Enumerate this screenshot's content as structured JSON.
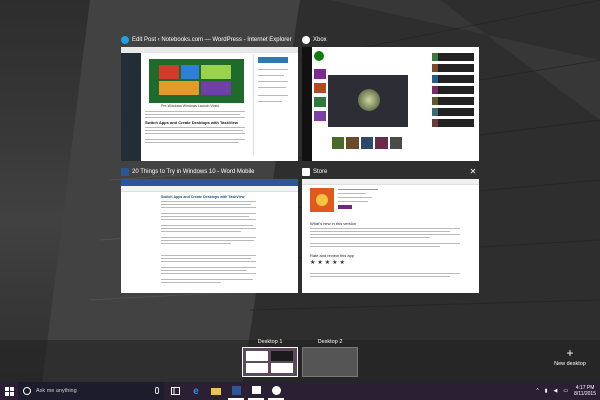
{
  "windows": [
    {
      "title": "Edit Post ‹ Notebooks.com — WordPress - Internet Explorer",
      "icon": "ie-icon"
    },
    {
      "title": "Xbox",
      "icon": "xbox-icon"
    },
    {
      "title": "20 Things to Try in Windows 10 - Word Mobile",
      "icon": "word-icon"
    },
    {
      "title": "Store",
      "icon": "store-icon"
    }
  ],
  "ie_doc": {
    "caption": "Pre-Windows Windows Launch Video",
    "heading": "Switch Apps and Create Desktops with TaskView"
  },
  "word_doc": {
    "heading": "Switch Apps and Create Desktops with TaskView"
  },
  "store_doc": {
    "heading1": "What's new in this version",
    "heading2": "Rate and review this app"
  },
  "desktops": [
    {
      "label": "Desktop 1",
      "active": true
    },
    {
      "label": "Desktop 2",
      "active": false
    }
  ],
  "new_desktop_label": "New desktop",
  "taskbar": {
    "search_placeholder": "Ask me anything",
    "time": "4:17 PM",
    "date": "8/11/2015"
  },
  "colors": {
    "accent": "#5a2a6a",
    "xbox_green": "#107c10",
    "word_blue": "#2b579a",
    "ie_blue": "#1ea1e0"
  }
}
